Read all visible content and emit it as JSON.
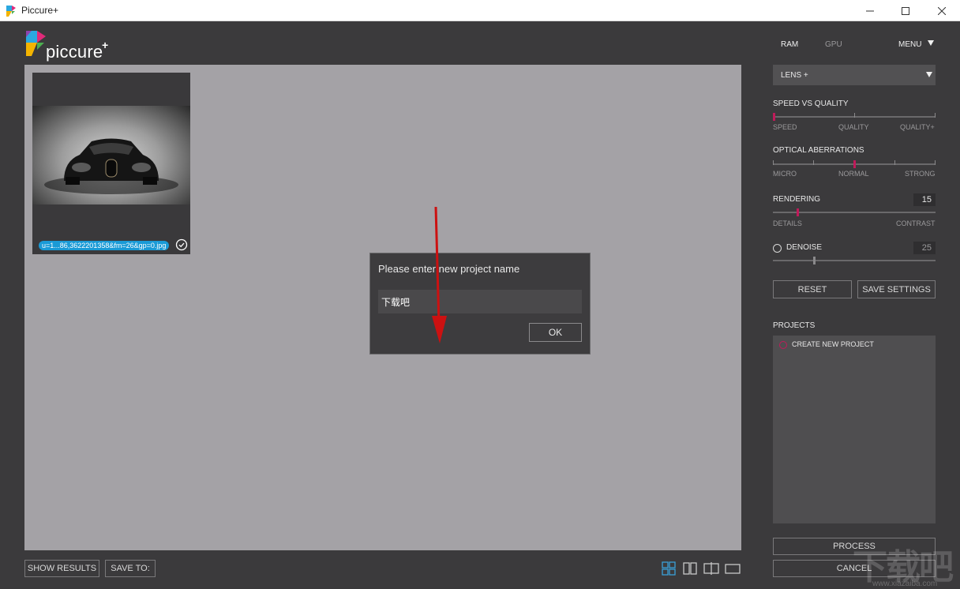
{
  "window": {
    "title": "Piccure+"
  },
  "logo": {
    "text": "piccure",
    "plus": "+"
  },
  "thumbnail": {
    "filename": "u=1...86,3622201358&fm=26&gp=0.jpg"
  },
  "dialog": {
    "title": "Please enter new project name",
    "input_value": "下载吧",
    "ok_label": "OK"
  },
  "bottom_bar": {
    "show_results_label": "SHOW RESULTS",
    "save_to_label": "SAVE TO:"
  },
  "right_panel": {
    "tabs": {
      "ram": "RAM",
      "gpu": "GPU"
    },
    "menu_label": "MENU",
    "lens_select": "LENS +",
    "speed_quality": {
      "label": "SPEED VS QUALITY",
      "ticks": [
        "SPEED",
        "QUALITY",
        "QUALITY+"
      ],
      "level": 0
    },
    "optical_aberrations": {
      "label": "OPTICAL ABERRATIONS",
      "ticks": [
        "MICRO",
        "NORMAL",
        "STRONG"
      ],
      "level": 0.5
    },
    "rendering": {
      "label": "RENDERING",
      "value": "15",
      "ticks": [
        "DETAILS",
        "CONTRAST"
      ],
      "level": 0.15
    },
    "denoise": {
      "label": "DENOISE",
      "value": "25",
      "level": 0.25,
      "enabled": false
    },
    "reset_label": "RESET",
    "save_settings_label": "SAVE SETTINGS",
    "projects": {
      "label": "PROJECTS",
      "create_new_label": "CREATE NEW PROJECT"
    },
    "process_label": "PROCESS",
    "cancel_label": "CANCEL"
  },
  "watermark": {
    "text": "下载吧",
    "sub": "www.xiazaiba.com"
  },
  "colors": {
    "accent": "#c01a5a",
    "badge": "#1a9ad6",
    "annotation": "#cc1111",
    "view_icon_active": "#3aa0d8"
  },
  "icons": {
    "window": [
      "app-icon",
      "minimize-icon",
      "maximize-icon",
      "close-icon"
    ],
    "views": [
      "grid-view-icon",
      "split-view-icon",
      "compare-view-icon",
      "single-view-icon"
    ]
  }
}
